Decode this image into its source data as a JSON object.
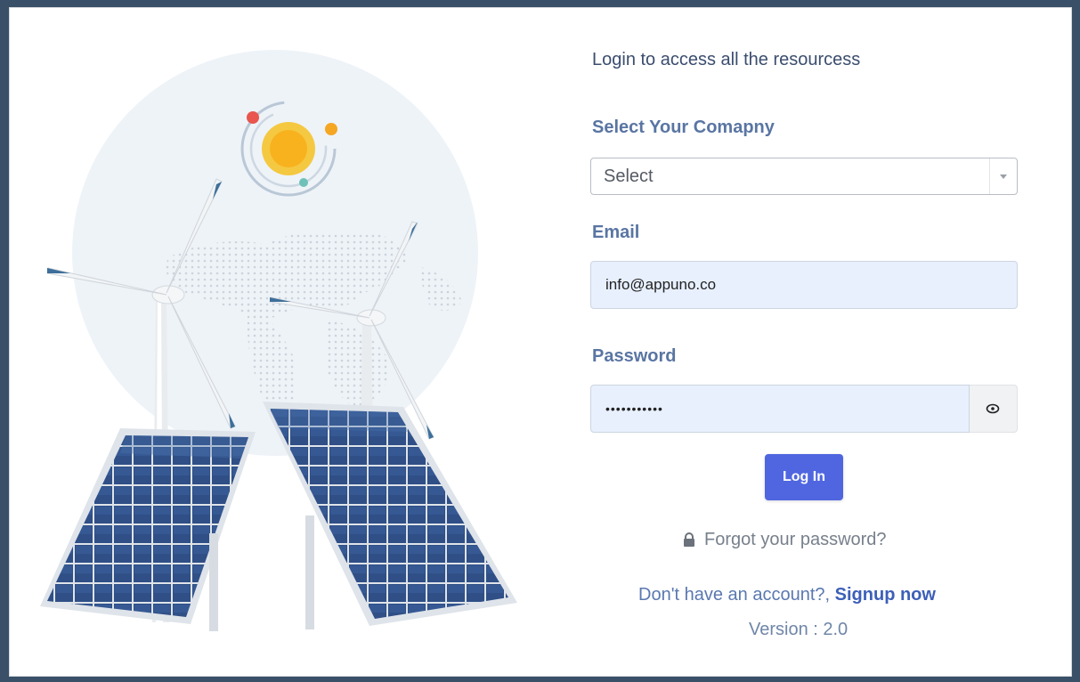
{
  "heading": "Login to access all the resourcess",
  "company": {
    "label": "Select Your Comapny",
    "selected": "Select"
  },
  "email": {
    "label": "Email",
    "value": "info@appuno.co"
  },
  "password": {
    "label": "Password",
    "value": "•••••••••••"
  },
  "login_button": "Log In",
  "forgot_password": "Forgot your password?",
  "signup": {
    "prompt": "Don't have an account?,",
    "link": "Signup now"
  },
  "version": "Version : 2.0",
  "colors": {
    "primary_button": "#4f66e0",
    "label": "#5975a3",
    "link": "#3d5fb8",
    "input_fill": "#e8f0fe"
  }
}
